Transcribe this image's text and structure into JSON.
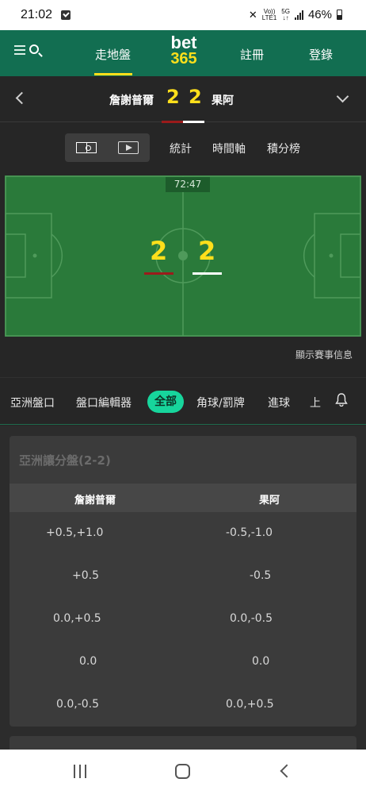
{
  "status_bar": {
    "time": "21:02",
    "network_top": "Vo))",
    "network_bottom": "LTE1",
    "data_top": "5G",
    "data_bottom": "↓↑",
    "battery": "46%"
  },
  "header": {
    "nav_live": "走地盤",
    "logo_line1": "bet",
    "logo_line2": "365",
    "register": "註冊",
    "login": "登錄"
  },
  "match": {
    "home_team": "詹謝普爾",
    "away_team": "果阿",
    "home_score": "2",
    "away_score": "2",
    "home_kit_color": "#9b1b1b",
    "away_kit_color": "#ffffff"
  },
  "view_tabs": [
    "統計",
    "時間軸",
    "積分榜"
  ],
  "field": {
    "clock": "72:47",
    "info_link": "顯示賽事信息"
  },
  "market_tabs": {
    "items": [
      "亞洲盤口",
      "盤口編輯器",
      "全部",
      "角球/罰牌",
      "進球",
      "上"
    ],
    "active_index": 2
  },
  "handicap": {
    "title": "亞洲讓分盤(2-2)",
    "home_header": "詹謝普爾",
    "away_header": "果阿",
    "rows": [
      {
        "home": "+0.5,+1.0",
        "away": "-0.5,-1.0"
      },
      {
        "home": "+0.5",
        "away": "-0.5"
      },
      {
        "home": "0.0,+0.5",
        "away": "0.0,-0.5"
      },
      {
        "home": "0.0",
        "away": "0.0"
      },
      {
        "home": "0.0,-0.5",
        "away": "0.0,+0.5"
      }
    ]
  },
  "colors": {
    "brand_green": "#126e51",
    "accent_yellow": "#ffdf1b",
    "active_tab": "#17d59c",
    "pitch": "#2a7a3a"
  }
}
